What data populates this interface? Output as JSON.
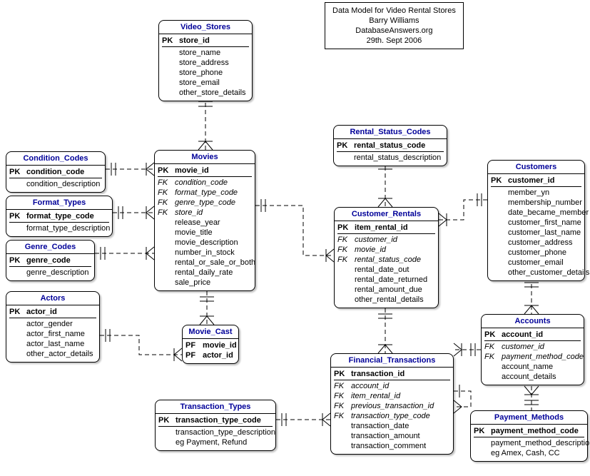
{
  "meta": {
    "line1": "Data Model for Video Rental Stores",
    "line2": "Barry Williams",
    "line3": "DatabaseAnswers.org",
    "line4": "29th. Sept 2006"
  },
  "entities": {
    "video_stores": {
      "title": "Video_Stores",
      "fields": [
        {
          "key": "PK",
          "name": "store_id",
          "bold": true
        },
        {
          "key": "",
          "name": "store_name"
        },
        {
          "key": "",
          "name": "store_address"
        },
        {
          "key": "",
          "name": "store_phone"
        },
        {
          "key": "",
          "name": "store_email"
        },
        {
          "key": "",
          "name": "other_store_details"
        }
      ]
    },
    "condition_codes": {
      "title": "Condition_Codes",
      "fields": [
        {
          "key": "PK",
          "name": "condition_code",
          "bold": true
        },
        {
          "key": "",
          "name": "condition_description"
        }
      ]
    },
    "format_types": {
      "title": "Format_Types",
      "fields": [
        {
          "key": "PK",
          "name": "format_type_code",
          "bold": true
        },
        {
          "key": "",
          "name": "format_type_description"
        }
      ]
    },
    "genre_codes": {
      "title": "Genre_Codes",
      "fields": [
        {
          "key": "PK",
          "name": "genre_code",
          "bold": true
        },
        {
          "key": "",
          "name": "genre_description"
        }
      ]
    },
    "actors": {
      "title": "Actors",
      "fields": [
        {
          "key": "PK",
          "name": "actor_id",
          "bold": true
        },
        {
          "key": "",
          "name": "actor_gender"
        },
        {
          "key": "",
          "name": "actor_first_name"
        },
        {
          "key": "",
          "name": "actor_last_name"
        },
        {
          "key": "",
          "name": "other_actor_details"
        }
      ]
    },
    "movies": {
      "title": "Movies",
      "fields": [
        {
          "key": "PK",
          "name": "movie_id",
          "bold": true
        },
        {
          "key": "FK",
          "name": "condition_code",
          "ital": true
        },
        {
          "key": "FK",
          "name": "format_type_code",
          "ital": true
        },
        {
          "key": "FK",
          "name": "genre_type_code",
          "ital": true
        },
        {
          "key": "FK",
          "name": "store_id",
          "ital": true
        },
        {
          "key": "",
          "name": "release_year"
        },
        {
          "key": "",
          "name": "movie_title"
        },
        {
          "key": "",
          "name": "movie_description"
        },
        {
          "key": "",
          "name": "number_in_stock"
        },
        {
          "key": "",
          "name": "rental_or_sale_or_both"
        },
        {
          "key": "",
          "name": "rental_daily_rate"
        },
        {
          "key": "",
          "name": "sale_price"
        }
      ]
    },
    "movie_cast": {
      "title": "Movie_Cast",
      "fields": [
        {
          "key": "PF",
          "name": "movie_id",
          "bold": true
        },
        {
          "key": "PF",
          "name": "actor_id",
          "bold": true
        }
      ]
    },
    "rental_status_codes": {
      "title": "Rental_Status_Codes",
      "fields": [
        {
          "key": "PK",
          "name": "rental_status_code",
          "bold": true
        },
        {
          "key": "",
          "name": "rental_status_description"
        }
      ]
    },
    "customer_rentals": {
      "title": "Customer_Rentals",
      "fields": [
        {
          "key": "PK",
          "name": "item_rental_id",
          "bold": true
        },
        {
          "key": "FK",
          "name": "customer_id",
          "ital": true
        },
        {
          "key": "FK",
          "name": "movie_id",
          "ital": true
        },
        {
          "key": "FK",
          "name": "rental_status_code",
          "ital": true
        },
        {
          "key": "",
          "name": "rental_date_out"
        },
        {
          "key": "",
          "name": "rental_date_returned"
        },
        {
          "key": "",
          "name": "rental_amount_due"
        },
        {
          "key": "",
          "name": "other_rental_details"
        }
      ]
    },
    "customers": {
      "title": "Customers",
      "fields": [
        {
          "key": "PK",
          "name": "customer_id",
          "bold": true
        },
        {
          "key": "",
          "name": "member_yn"
        },
        {
          "key": "",
          "name": "membership_number"
        },
        {
          "key": "",
          "name": "date_became_member"
        },
        {
          "key": "",
          "name": "customer_first_name"
        },
        {
          "key": "",
          "name": "customer_last_name"
        },
        {
          "key": "",
          "name": "customer_address"
        },
        {
          "key": "",
          "name": "customer_phone"
        },
        {
          "key": "",
          "name": "customer_email"
        },
        {
          "key": "",
          "name": "other_customer_details"
        }
      ]
    },
    "accounts": {
      "title": "Accounts",
      "fields": [
        {
          "key": "PK",
          "name": "account_id",
          "bold": true
        },
        {
          "key": "FK",
          "name": "customer_id",
          "ital": true
        },
        {
          "key": "FK",
          "name": "payment_method_code",
          "ital": true
        },
        {
          "key": "",
          "name": "account_name"
        },
        {
          "key": "",
          "name": "account_details"
        }
      ]
    },
    "payment_methods": {
      "title": "Payment_Methods",
      "fields": [
        {
          "key": "PK",
          "name": "payment_method_code",
          "bold": true
        },
        {
          "key": "",
          "name": "payment_method_description"
        },
        {
          "key": "",
          "name": "eg Amex, Cash, CC"
        }
      ]
    },
    "financial_transactions": {
      "title": "Financial_Transactions",
      "fields": [
        {
          "key": "PK",
          "name": "transaction_id",
          "bold": true
        },
        {
          "key": "FK",
          "name": "account_id",
          "ital": true
        },
        {
          "key": "FK",
          "name": "item_rental_id",
          "ital": true
        },
        {
          "key": "FK",
          "name": "previous_transaction_id",
          "ital": true
        },
        {
          "key": "FK",
          "name": "transaction_type_code",
          "ital": true
        },
        {
          "key": "",
          "name": "transaction_date"
        },
        {
          "key": "",
          "name": "transaction_amount"
        },
        {
          "key": "",
          "name": "transaction_comment"
        }
      ]
    },
    "transaction_types": {
      "title": "Transaction_Types",
      "fields": [
        {
          "key": "PK",
          "name": "transaction_type_code",
          "bold": true
        },
        {
          "key": "",
          "name": "transaction_type_description"
        },
        {
          "key": "",
          "name": "eg Payment, Refund"
        }
      ]
    }
  }
}
